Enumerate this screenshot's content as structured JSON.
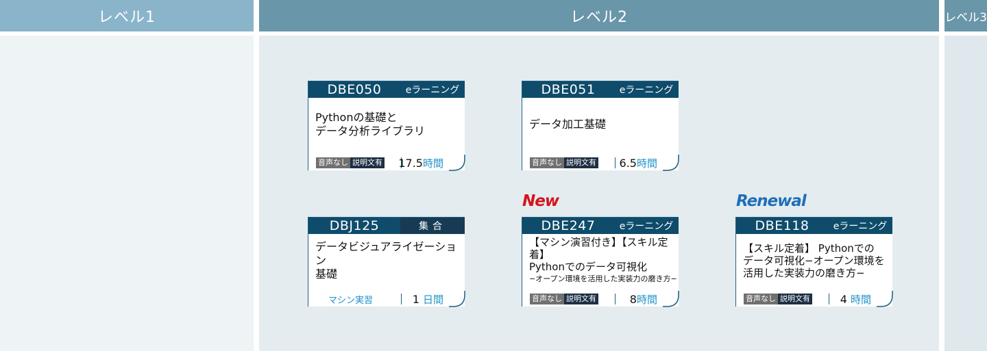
{
  "columns": {
    "level1": "レベル1",
    "level2": "レベル2",
    "level3": "レベル3"
  },
  "cards": [
    {
      "code": "DBE050",
      "type": "eラーニング",
      "title_lines": [
        "Pythonの基礎と",
        "データ分析ライブラリ"
      ],
      "badge_a": "音声なし",
      "badge_b": "説明文有",
      "hours": "17.5",
      "unit": "時間"
    },
    {
      "code": "DBE051",
      "type": "eラーニング",
      "title_lines": [
        "データ加工基礎"
      ],
      "badge_a": "音声なし",
      "badge_b": "説明文有",
      "hours": "6.5",
      "unit": "時間"
    },
    {
      "code": "DBJ125",
      "type": "集合",
      "title_lines": [
        "データビジュアライゼーション",
        "基礎"
      ],
      "machine": "マシン実習",
      "hours": "1",
      "unit": "日間"
    },
    {
      "code": "DBE247",
      "type": "eラーニング",
      "marker": "New",
      "title_lines": [
        "【マシン演習付き】【スキル定着】",
        "Pythonでのデータ可視化",
        "−オープン環境を活用した実装力の磨き方−"
      ],
      "badge_a": "音声なし",
      "badge_b": "説明文有",
      "hours": "8",
      "unit": "時間"
    },
    {
      "code": "DBE118",
      "type": "eラーニング",
      "marker": "Renewal",
      "title_lines": [
        "【スキル定着】 Pythonでの",
        "データ可視化−オープン環境を",
        "活用した実装力の磨き方−"
      ],
      "badge_a": "音声なし",
      "badge_b": "説明文有",
      "hours": "4",
      "unit": "時間"
    }
  ],
  "colors": {
    "header_light": "#8ab4c9",
    "header_dark": "#6997a9",
    "card_navy": "#0f4c6c",
    "accent_blue": "#1f91c9",
    "new_red": "#d6141e",
    "renewal_blue": "#1e6fb8"
  }
}
